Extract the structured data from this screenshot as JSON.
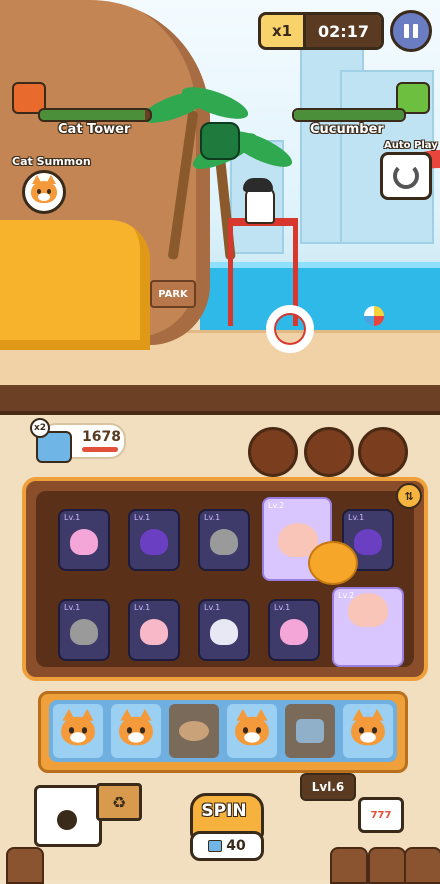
{
  "hud": {
    "speed": "x1",
    "timer": "02:17",
    "left_base": "Cat Tower",
    "right_base": "Cucumber",
    "auto_play": "Auto Play",
    "summon_label": "Cat Summon",
    "left_hp_fraction": 0.95,
    "right_hp_fraction": 1.0
  },
  "scene": {
    "park_sign": "PARK"
  },
  "bottom": {
    "coin_multiplier": "x2",
    "coins": "1678",
    "level": "Lvl.6",
    "spin_label": "SPIN",
    "spin_cost": "40",
    "board_cards_row1": [
      "Lv.1",
      "Lv.1",
      "Lv.1",
      "Lv.2",
      "Lv.1"
    ],
    "board_cards_row2": [
      "Lv.1",
      "Lv.1",
      "Lv.1",
      "Lv.1",
      "Lv.2"
    ],
    "spin_slots": [
      "cat",
      "cat",
      "fish",
      "cat",
      "can",
      "cat"
    ]
  },
  "colors": {
    "accent_orange": "#f0a03a",
    "board_bg": "#5a3018",
    "hp_left": "#4c8f3a",
    "hp_right": "#4c8f3a"
  }
}
